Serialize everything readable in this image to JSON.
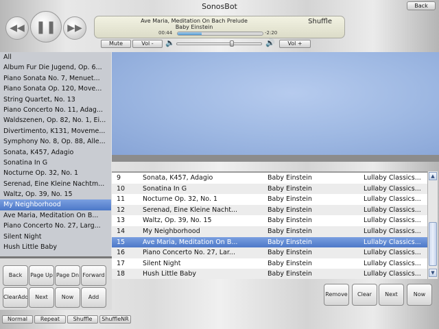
{
  "app": {
    "title": "SonosBot",
    "back_label": "Back"
  },
  "transport": {
    "prev_icon": "skip-back-icon",
    "pause_icon": "pause-icon",
    "next_icon": "skip-forward-icon"
  },
  "now_playing": {
    "title": "Ave Maria, Meditation On Bach Prelude",
    "artist": "Baby Einstein",
    "mode": "Shuffle",
    "elapsed": "00:44",
    "remaining": "-2:20",
    "progress": 0.28
  },
  "volume": {
    "mute_label": "Mute",
    "vol_down_label": "Vol -",
    "vol_up_label": "Vol +",
    "level": 0.65
  },
  "albums": [
    "All",
    "Album Fur Die Jugend, Op. 6...",
    "Piano Sonata No. 7, Menuet...",
    "Piano Sonata Op. 120, Move...",
    "String Quartet, No. 13",
    "Piano Concerto No. 11, Adag...",
    "Waldszenen, Op. 82, No. 1, Ei...",
    "Divertimento, K131, Moveme...",
    "Symphony No. 8, Op. 88, Alle...",
    "Sonata, K457, Adagio",
    "Sonatina In G",
    "Nocturne Op. 32, No. 1",
    "Serenad, Eine Kleine Nachtm...",
    "Waltz, Op. 39, No. 15",
    "My Neighborhood",
    "Ave Maria, Meditation On B...",
    "Piano Concerto No. 27, Larg...",
    "Silent Night",
    "Hush Little Baby"
  ],
  "selected_album_index": 14,
  "nav_buttons": {
    "back": "Back",
    "page_up": "Page Up",
    "page_down": "Page Dn",
    "forward": "Forward",
    "clear_add": "ClearAdd",
    "next": "Next",
    "now": "Now",
    "add": "Add"
  },
  "tracks": [
    {
      "num": "9",
      "title": "Sonata, K457, Adagio",
      "artist": "Baby Einstein",
      "album": "Lullaby Classics..."
    },
    {
      "num": "10",
      "title": "Sonatina In G",
      "artist": "Baby Einstein",
      "album": "Lullaby Classics..."
    },
    {
      "num": "11",
      "title": "Nocturne Op. 32, No. 1",
      "artist": "Baby Einstein",
      "album": "Lullaby Classics..."
    },
    {
      "num": "12",
      "title": "Serenad, Eine Kleine Nacht...",
      "artist": "Baby Einstein",
      "album": "Lullaby Classics..."
    },
    {
      "num": "13",
      "title": "Waltz, Op. 39, No. 15",
      "artist": "Baby Einstein",
      "album": "Lullaby Classics..."
    },
    {
      "num": "14",
      "title": "My Neighborhood",
      "artist": "Baby Einstein",
      "album": "Lullaby Classics..."
    },
    {
      "num": "15",
      "title": "Ave Maria, Meditation On B...",
      "artist": "Baby Einstein",
      "album": "Lullaby Classics..."
    },
    {
      "num": "16",
      "title": "Piano Concerto No. 27, Lar...",
      "artist": "Baby Einstein",
      "album": "Lullaby Classics..."
    },
    {
      "num": "17",
      "title": "Silent Night",
      "artist": "Baby Einstein",
      "album": "Lullaby Classics..."
    },
    {
      "num": "18",
      "title": "Hush Little Baby",
      "artist": "Baby Einstein",
      "album": "Lullaby Classics..."
    }
  ],
  "selected_track_index": 6,
  "queue_actions": {
    "remove": "Remove",
    "clear": "Clear",
    "next": "Next",
    "now": "Now"
  },
  "play_modes": {
    "normal": "Normal",
    "repeat": "Repeat",
    "shuffle": "Shuffle",
    "shuffle_nr": "ShuffleNR"
  }
}
